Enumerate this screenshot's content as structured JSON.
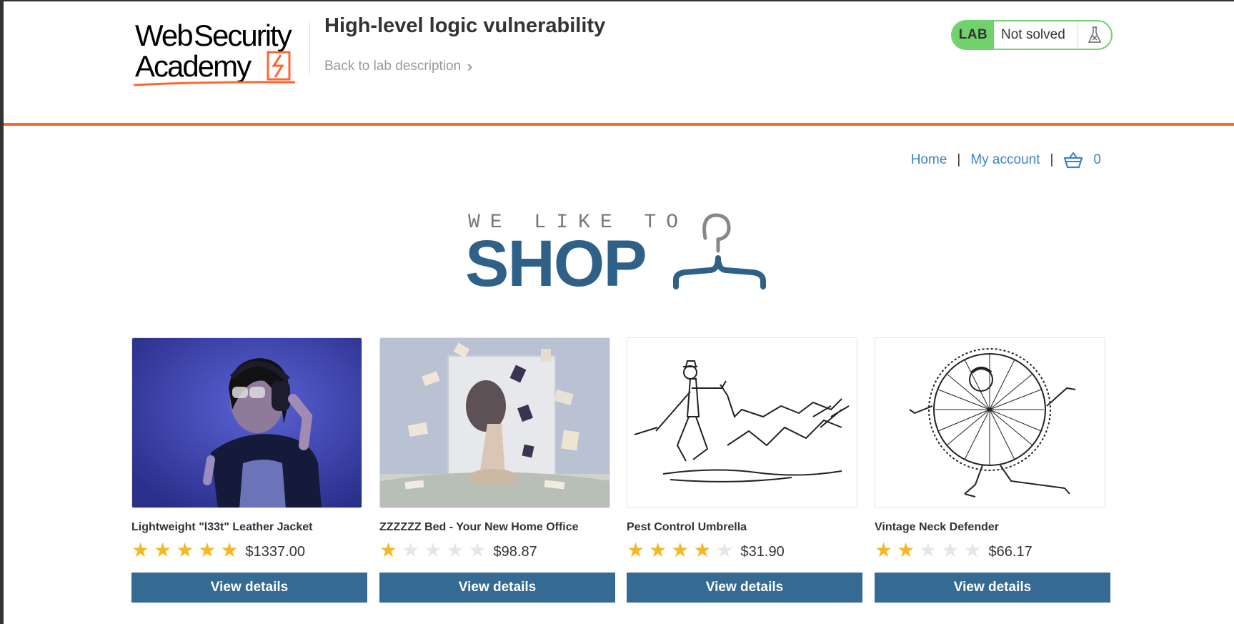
{
  "header": {
    "logo_text": "Web Security Academy",
    "lab_title": "High-level logic vulnerability",
    "back_link": "Back to lab description",
    "lab_badge": "LAB",
    "lab_status": "Not solved"
  },
  "nav": {
    "home": "Home",
    "separator": "|",
    "my_account": "My account",
    "cart_count": "0"
  },
  "banner": {
    "top_text": "WE LIKE TO",
    "main_text": "SHOP"
  },
  "products": [
    {
      "name": "Lightweight \"l33t\" Leather Jacket",
      "rating": 5,
      "price": "$1337.00",
      "button": "View details",
      "image": "person-with-headphones-photo"
    },
    {
      "name": "ZZZZZZ Bed - Your New Home Office",
      "rating": 1,
      "price": "$98.87",
      "button": "View details",
      "image": "woman-on-bed-with-flying-books-photo"
    },
    {
      "name": "Pest Control Umbrella",
      "rating": 4,
      "price": "$31.90",
      "button": "View details",
      "image": "man-with-umbrella-chasing-rats-sketch"
    },
    {
      "name": "Vintage Neck Defender",
      "rating": 2,
      "price": "$66.17",
      "button": "View details",
      "image": "man-in-giant-ruff-collar-sketch"
    }
  ],
  "colors": {
    "brand_orange": "#ff6633",
    "lab_green": "#70d16d",
    "link_blue": "#3d82c4",
    "button_blue": "#356a93",
    "star_gold": "#f3b823"
  }
}
